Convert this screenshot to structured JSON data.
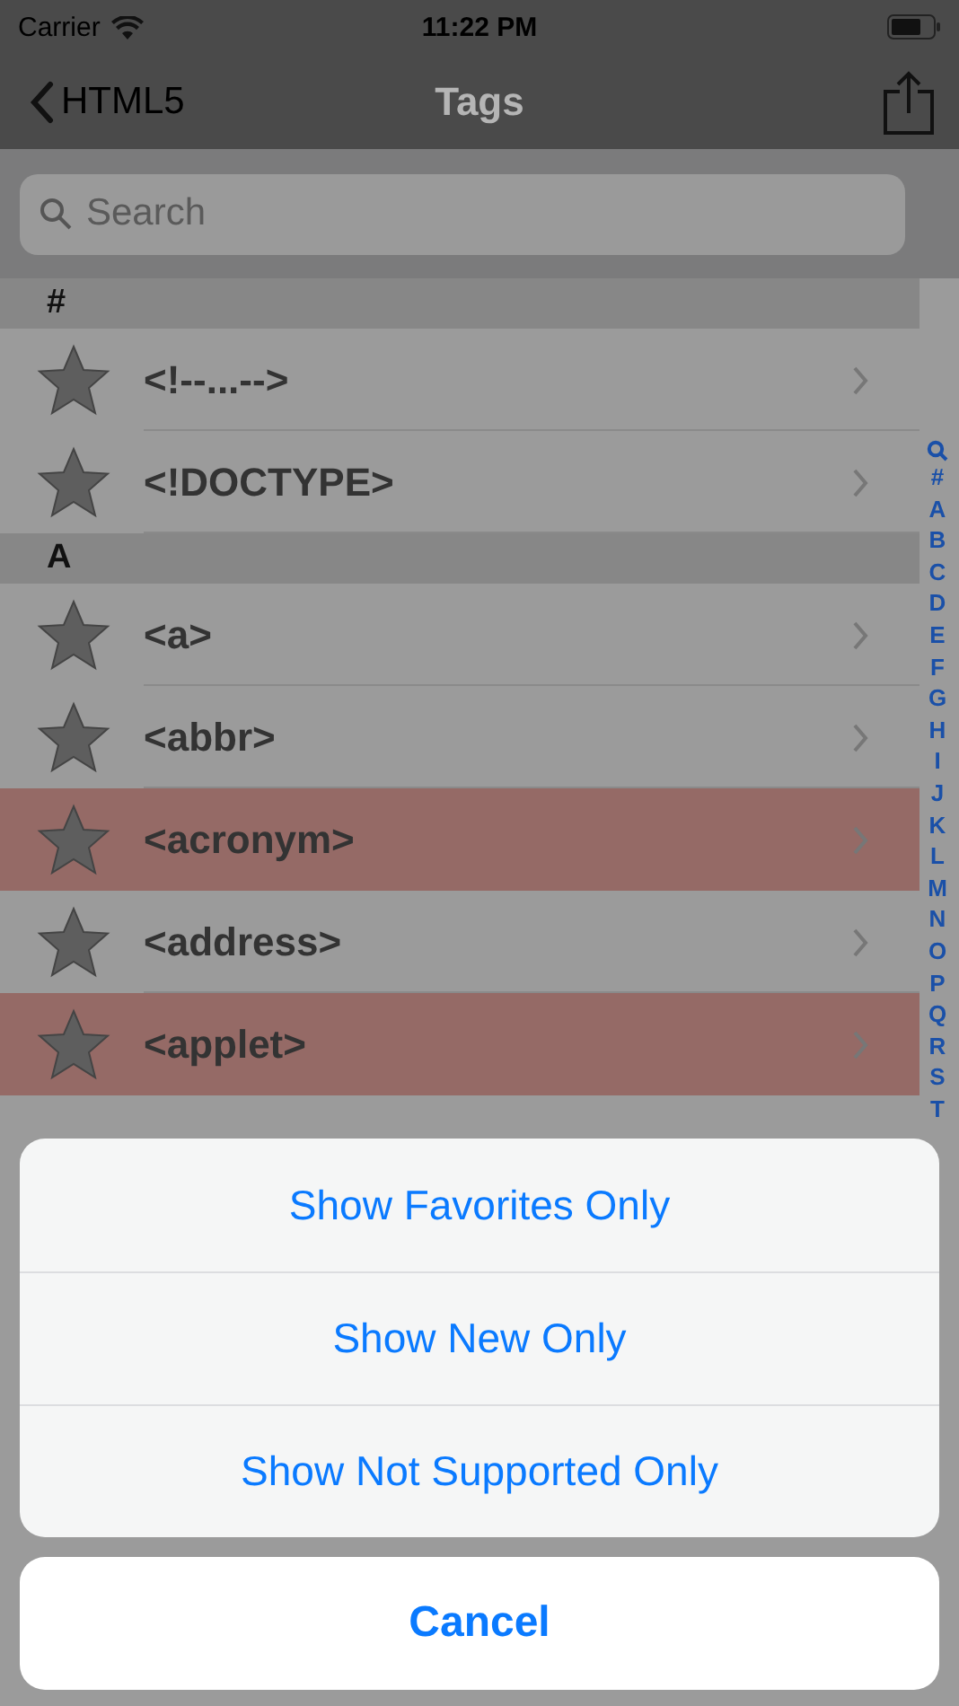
{
  "status_bar": {
    "carrier": "Carrier",
    "time": "11:22 PM"
  },
  "nav": {
    "back": "HTML5",
    "title": "Tags"
  },
  "search": {
    "placeholder": "Search"
  },
  "sections": [
    {
      "header": "#",
      "rows": [
        {
          "label": "<!--...-->",
          "not_supported": false
        },
        {
          "label": "<!DOCTYPE>",
          "not_supported": false
        }
      ]
    },
    {
      "header": "A",
      "rows": [
        {
          "label": "<a>",
          "not_supported": false
        },
        {
          "label": "<abbr>",
          "not_supported": false
        },
        {
          "label": "<acronym>",
          "not_supported": true
        },
        {
          "label": "<address>",
          "not_supported": false
        },
        {
          "label": "<applet>",
          "not_supported": true
        }
      ]
    }
  ],
  "index": [
    "#",
    "A",
    "B",
    "C",
    "D",
    "E",
    "F",
    "G",
    "H",
    "I",
    "J",
    "K",
    "L",
    "M",
    "N",
    "O",
    "P",
    "Q",
    "R",
    "S",
    "T"
  ],
  "action_sheet": {
    "options": [
      "Show Favorites Only",
      "Show New Only",
      "Show Not Supported Only"
    ],
    "cancel": "Cancel"
  }
}
